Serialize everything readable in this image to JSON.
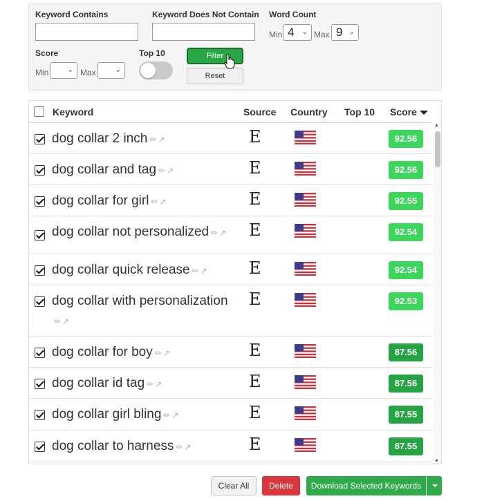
{
  "filters": {
    "keyword_contains_label": "Keyword Contains",
    "keyword_contains_value": "",
    "keyword_not_contain_label": "Keyword Does Not Contain",
    "keyword_not_contain_value": "",
    "word_count_label": "Word Count",
    "word_count_min_label": "Min",
    "word_count_min_value": "4",
    "word_count_max_label": "Max",
    "word_count_max_value": "9",
    "score_label": "Score",
    "score_min_label": "Min",
    "score_min_value": "",
    "score_max_label": "Max",
    "score_max_value": "",
    "top10_label": "Top 10",
    "top10_on": false,
    "filter_button": "Filter",
    "reset_button": "Reset"
  },
  "table": {
    "headers": {
      "keyword": "Keyword",
      "source": "Source",
      "country": "Country",
      "top10": "Top 10",
      "score": "Score"
    },
    "rows": [
      {
        "keyword": "dog collar 2 inch",
        "source": "E",
        "country": "us-flag",
        "score": "92.56",
        "checked": true
      },
      {
        "keyword": "dog collar and tag",
        "source": "E",
        "country": "us-flag",
        "score": "92.56",
        "checked": true
      },
      {
        "keyword": "dog collar for girl",
        "source": "E",
        "country": "us-flag",
        "score": "92.55",
        "checked": true
      },
      {
        "keyword": "dog collar not personalized",
        "source": "E",
        "country": "us-flag",
        "score": "92.54",
        "checked": true
      },
      {
        "keyword": "dog collar quick release",
        "source": "E",
        "country": "us-flag",
        "score": "92.54",
        "checked": true
      },
      {
        "keyword": "dog collar with personalization",
        "source": "E",
        "country": "us-flag",
        "score": "92.53",
        "checked": true
      },
      {
        "keyword": "dog collar for boy",
        "source": "E",
        "country": "us-flag",
        "score": "87.56",
        "checked": true
      },
      {
        "keyword": "dog collar id tag",
        "source": "E",
        "country": "us-flag",
        "score": "87.56",
        "checked": true
      },
      {
        "keyword": "dog collar girl bling",
        "source": "E",
        "country": "us-flag",
        "score": "87.55",
        "checked": true
      },
      {
        "keyword": "dog collar to harness",
        "source": "E",
        "country": "us-flag",
        "score": "87.55",
        "checked": true
      }
    ]
  },
  "colors": {
    "score_high": "#3dd65c",
    "score_mid": "#26a444",
    "filter_green": "#27a844",
    "delete_red": "#d9363e"
  },
  "actions": {
    "clear_all": "Clear All",
    "delete": "Delete",
    "download": "Download Selected Keywords"
  }
}
